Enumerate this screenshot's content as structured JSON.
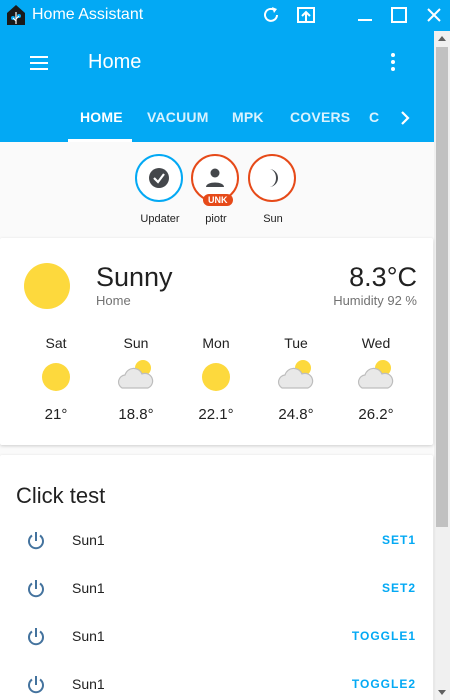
{
  "window": {
    "title": "Home Assistant"
  },
  "header": {
    "title": "Home"
  },
  "tabs": [
    {
      "label": "HOME",
      "active": true
    },
    {
      "label": "VACUUM"
    },
    {
      "label": "MPK"
    },
    {
      "label": "COVERS"
    },
    {
      "label": "C"
    }
  ],
  "badges": [
    {
      "label": "Updater",
      "icon": "check-circle-icon",
      "color": "#03a9f4"
    },
    {
      "label": "piotr",
      "icon": "account-icon",
      "color": "#e64a19",
      "tag": "UNK"
    },
    {
      "label": "Sun",
      "icon": "moon-icon",
      "color": "#e64a19"
    }
  ],
  "weather": {
    "condition": "Sunny",
    "name": "Home",
    "temperature": "8.3°C",
    "humidity": "Humidity 92 %",
    "forecast": [
      {
        "day": "Sat",
        "temp": "21°",
        "icon": "sunny-icon"
      },
      {
        "day": "Sun",
        "temp": "18.8°",
        "icon": "partly-cloudy-icon"
      },
      {
        "day": "Mon",
        "temp": "22.1°",
        "icon": "sunny-icon"
      },
      {
        "day": "Tue",
        "temp": "24.8°",
        "icon": "partly-cloudy-icon"
      },
      {
        "day": "Wed",
        "temp": "26.2°",
        "icon": "partly-cloudy-icon"
      }
    ]
  },
  "click_test": {
    "title": "Click test",
    "rows": [
      {
        "name": "Sun1",
        "button": "SET1"
      },
      {
        "name": "Sun1",
        "button": "SET2"
      },
      {
        "name": "Sun1",
        "button": "TOGGLE1"
      },
      {
        "name": "Sun1",
        "button": "TOGGLE2"
      }
    ]
  },
  "colors": {
    "primary": "#03a9f4",
    "accent": "#e64a19",
    "sun": "#fdd93d"
  }
}
